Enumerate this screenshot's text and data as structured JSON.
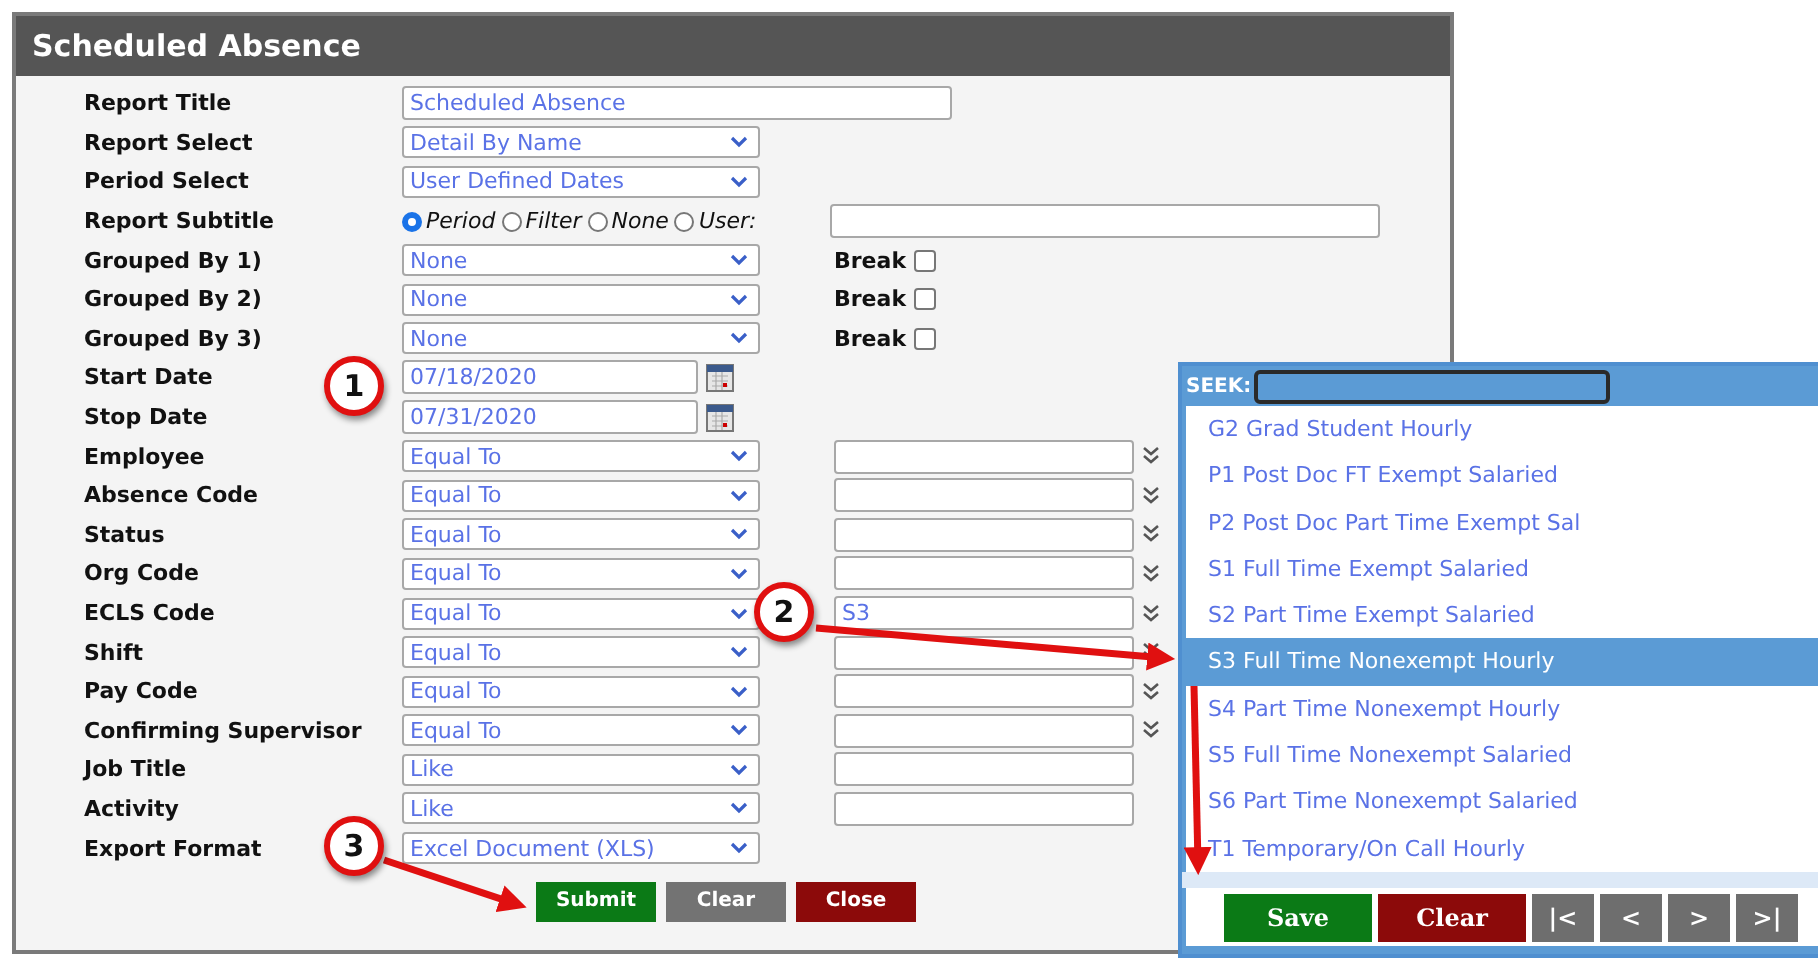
{
  "window": {
    "title": "Scheduled Absence"
  },
  "form": {
    "rows": [
      {
        "kind": "text",
        "label": "Report Title",
        "value": "Scheduled Absence"
      },
      {
        "kind": "select",
        "label": "Report Select",
        "value": "Detail By Name"
      },
      {
        "kind": "select",
        "label": "Period Select",
        "value": "User Defined Dates"
      },
      {
        "kind": "radios",
        "label": "Report Subtitle",
        "options": [
          {
            "label": "Period",
            "selected": true
          },
          {
            "label": "Filter",
            "selected": false
          },
          {
            "label": "None",
            "selected": false
          },
          {
            "label": "User:",
            "selected": false
          }
        ]
      },
      {
        "kind": "group",
        "label": "Grouped By 1)",
        "value": "None",
        "break": {
          "label": "Break",
          "checked": false
        }
      },
      {
        "kind": "group",
        "label": "Grouped By 2)",
        "value": "None",
        "break": {
          "label": "Break",
          "checked": false
        }
      },
      {
        "kind": "group",
        "label": "Grouped By 3)",
        "value": "None",
        "break": {
          "label": "Break",
          "checked": false
        }
      },
      {
        "kind": "date",
        "label": "Start Date",
        "value": "07/18/2020"
      },
      {
        "kind": "date",
        "label": "Stop Date",
        "value": "07/31/2020"
      },
      {
        "kind": "filter",
        "label": "Employee",
        "value": "Equal To",
        "lookup": true
      },
      {
        "kind": "filter",
        "label": "Absence Code",
        "value": "Equal To",
        "lookup": true
      },
      {
        "kind": "filter",
        "label": "Status",
        "value": "Equal To",
        "lookup": true
      },
      {
        "kind": "filter",
        "label": "Org Code",
        "value": "Equal To",
        "lookup": true
      },
      {
        "kind": "filter",
        "label": "ECLS Code",
        "value": "Equal To",
        "lookup": true,
        "input": "S3"
      },
      {
        "kind": "filter",
        "label": "Shift",
        "value": "Equal To",
        "lookup": true
      },
      {
        "kind": "filter",
        "label": "Pay Code",
        "value": "Equal To",
        "lookup": true
      },
      {
        "kind": "filter",
        "label": "Confirming Supervisor",
        "value": "Equal To",
        "lookup": true
      },
      {
        "kind": "filter",
        "label": "Job Title",
        "value": "Like",
        "lookup": false
      },
      {
        "kind": "filter",
        "label": "Activity",
        "value": "Like",
        "lookup": false
      },
      {
        "kind": "select",
        "label": "Export Format",
        "value": "Excel Document (XLS)"
      }
    ],
    "buttons": [
      {
        "label": "Submit",
        "kind": "go"
      },
      {
        "label": "Clear",
        "kind": "neutral"
      },
      {
        "label": "Close",
        "kind": "stop"
      }
    ]
  },
  "seek_popup": {
    "label": "SEEK:",
    "items": [
      {
        "label": "G2 Grad Student Hourly",
        "selected": false
      },
      {
        "label": "P1 Post Doc FT Exempt Salaried",
        "selected": false
      },
      {
        "label": "P2 Post Doc Part Time Exempt Sal",
        "selected": false
      },
      {
        "label": "S1 Full Time Exempt Salaried",
        "selected": false
      },
      {
        "label": "S2 Part Time Exempt Salaried",
        "selected": false
      },
      {
        "label": "S3 Full Time Nonexempt Hourly",
        "selected": true
      },
      {
        "label": "S4 Part Time Nonexempt Hourly",
        "selected": false
      },
      {
        "label": "S5 Full Time Nonexempt Salaried",
        "selected": false
      },
      {
        "label": "S6 Part Time Nonexempt Salaried",
        "selected": false
      },
      {
        "label": "T1 Temporary/On Call Hourly",
        "selected": false
      }
    ],
    "buttons": [
      {
        "label": "Save",
        "kind": "go"
      },
      {
        "label": "Clear",
        "kind": "stop"
      },
      {
        "label": "|<",
        "kind": "nav"
      },
      {
        "label": "<",
        "kind": "nav"
      },
      {
        "label": ">",
        "kind": "nav"
      },
      {
        "label": ">|",
        "kind": "nav"
      }
    ]
  },
  "callouts": [
    {
      "label": "1"
    },
    {
      "label": "2"
    },
    {
      "label": "3"
    }
  ]
}
